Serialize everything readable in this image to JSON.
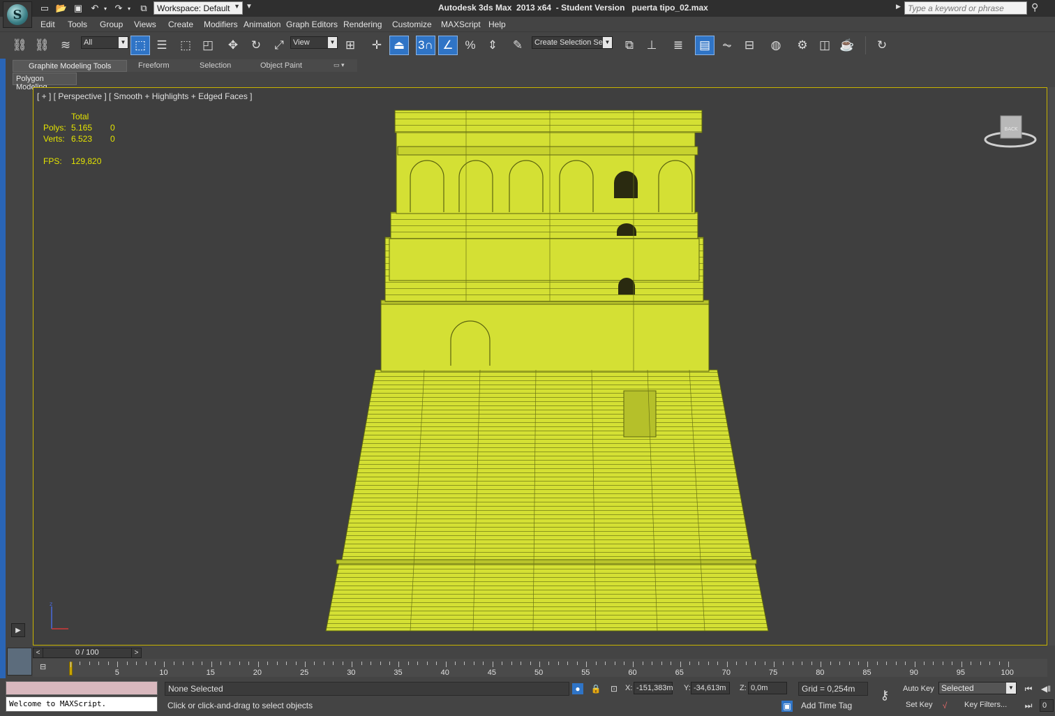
{
  "title": {
    "app_name": "Autodesk 3ds Max  2013 x64  - Student Version   puerta tipo_02.max",
    "workspace": "Workspace: Default",
    "search_placeholder": "Type a keyword or phrase"
  },
  "menu": [
    "Edit",
    "Tools",
    "Group",
    "Views",
    "Create",
    "Modifiers",
    "Animation",
    "Graph Editors",
    "Rendering",
    "Customize",
    "MAXScript",
    "Help"
  ],
  "toolbar": {
    "filter_value": "All",
    "ref_coord": "View",
    "selection_set_placeholder": "Create Selection Se",
    "snap_label": "3"
  },
  "ribbon": {
    "tabs": [
      "Graphite Modeling Tools",
      "Freeform",
      "Selection",
      "Object Paint"
    ],
    "active_panel": "Polygon Modeling"
  },
  "viewport": {
    "label": "[ + ] [ Perspective ] [ Smooth + Highlights + Edged Faces ]",
    "stats": {
      "total_header": "Total",
      "polys_label": "Polys:",
      "polys_total": "5.165",
      "polys_sel": "0",
      "verts_label": "Verts:",
      "verts_total": "6.523",
      "verts_sel": "0",
      "fps_label": "FPS:",
      "fps_value": "129,820"
    },
    "viewcube_face": "BACK",
    "model_color": "#d4e034",
    "edge_color": "#5c6410"
  },
  "timeline": {
    "frame_display": "0 / 100",
    "ticks": [
      5,
      10,
      15,
      20,
      25,
      30,
      35,
      40,
      45,
      50,
      55,
      60,
      65,
      70,
      75,
      80,
      85,
      90,
      95,
      100
    ]
  },
  "status": {
    "maxscript_output": "Welcome to MAXScript.",
    "selection": "None Selected",
    "prompt": "Click or click-and-drag to select objects",
    "x_label": "X:",
    "x_value": "-151,383m",
    "y_label": "Y:",
    "y_value": "-34,613m",
    "z_label": "Z:",
    "z_value": "0,0m",
    "grid": "Grid = 0,254m",
    "add_time_tag": "Add Time Tag",
    "auto_key": "Auto Key",
    "set_key": "Set Key",
    "key_mode": "Selected",
    "key_filters": "Key Filters...",
    "frame_field": "0"
  }
}
